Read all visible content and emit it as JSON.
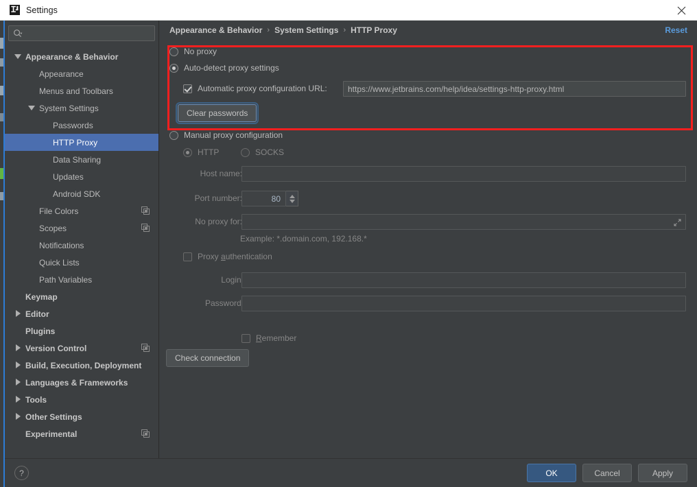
{
  "titlebar": {
    "title": "Settings",
    "app_icon": "intellij-idea-icon",
    "close_icon": "close-icon"
  },
  "sidebar": {
    "search": {
      "icon": "search-icon",
      "value": "",
      "placeholder": ""
    },
    "items": [
      {
        "label": "Appearance & Behavior",
        "depth": 0,
        "bold": true,
        "arrow": "down",
        "selected": false,
        "copy": false
      },
      {
        "label": "Appearance",
        "depth": 1,
        "bold": false,
        "arrow": "none",
        "selected": false,
        "copy": false
      },
      {
        "label": "Menus and Toolbars",
        "depth": 1,
        "bold": false,
        "arrow": "none",
        "selected": false,
        "copy": false
      },
      {
        "label": "System Settings",
        "depth": 1,
        "bold": false,
        "arrow": "down",
        "selected": false,
        "copy": false
      },
      {
        "label": "Passwords",
        "depth": 2,
        "bold": false,
        "arrow": "none",
        "selected": false,
        "copy": false
      },
      {
        "label": "HTTP Proxy",
        "depth": 2,
        "bold": false,
        "arrow": "none",
        "selected": true,
        "copy": false
      },
      {
        "label": "Data Sharing",
        "depth": 2,
        "bold": false,
        "arrow": "none",
        "selected": false,
        "copy": false
      },
      {
        "label": "Updates",
        "depth": 2,
        "bold": false,
        "arrow": "none",
        "selected": false,
        "copy": false
      },
      {
        "label": "Android SDK",
        "depth": 2,
        "bold": false,
        "arrow": "none",
        "selected": false,
        "copy": false
      },
      {
        "label": "File Colors",
        "depth": 1,
        "bold": false,
        "arrow": "none",
        "selected": false,
        "copy": true
      },
      {
        "label": "Scopes",
        "depth": 1,
        "bold": false,
        "arrow": "none",
        "selected": false,
        "copy": true
      },
      {
        "label": "Notifications",
        "depth": 1,
        "bold": false,
        "arrow": "none",
        "selected": false,
        "copy": false
      },
      {
        "label": "Quick Lists",
        "depth": 1,
        "bold": false,
        "arrow": "none",
        "selected": false,
        "copy": false
      },
      {
        "label": "Path Variables",
        "depth": 1,
        "bold": false,
        "arrow": "none",
        "selected": false,
        "copy": false
      },
      {
        "label": "Keymap",
        "depth": 0,
        "bold": true,
        "arrow": "none",
        "selected": false,
        "copy": false
      },
      {
        "label": "Editor",
        "depth": 0,
        "bold": true,
        "arrow": "right",
        "selected": false,
        "copy": false
      },
      {
        "label": "Plugins",
        "depth": 0,
        "bold": true,
        "arrow": "none",
        "selected": false,
        "copy": false
      },
      {
        "label": "Version Control",
        "depth": 0,
        "bold": true,
        "arrow": "right",
        "selected": false,
        "copy": true
      },
      {
        "label": "Build, Execution, Deployment",
        "depth": 0,
        "bold": true,
        "arrow": "right",
        "selected": false,
        "copy": false
      },
      {
        "label": "Languages & Frameworks",
        "depth": 0,
        "bold": true,
        "arrow": "right",
        "selected": false,
        "copy": false
      },
      {
        "label": "Tools",
        "depth": 0,
        "bold": true,
        "arrow": "right",
        "selected": false,
        "copy": false
      },
      {
        "label": "Other Settings",
        "depth": 0,
        "bold": true,
        "arrow": "right",
        "selected": false,
        "copy": false
      },
      {
        "label": "Experimental",
        "depth": 0,
        "bold": true,
        "arrow": "none",
        "selected": false,
        "copy": true
      }
    ]
  },
  "breadcrumb": {
    "items": [
      "Appearance & Behavior",
      "System Settings",
      "HTTP Proxy"
    ],
    "separator": "›",
    "reset_label": "Reset"
  },
  "proxy": {
    "no_proxy_label": "No proxy",
    "no_proxy_selected": false,
    "auto_detect_label": "Auto-detect proxy settings",
    "auto_detect_selected": true,
    "auto_url_checkbox_label": "Automatic proxy configuration URL:",
    "auto_url_checked": true,
    "auto_url_value": "https://www.jetbrains.com/help/idea/settings-http-proxy.html",
    "clear_passwords_label": "Clear passwords",
    "manual_label": "Manual proxy configuration",
    "manual_selected": false,
    "http_label": "HTTP",
    "http_selected": true,
    "socks_label": "SOCKS",
    "socks_selected": false,
    "host_label": "Host name:",
    "host_value": "",
    "port_label": "Port number:",
    "port_value": "80",
    "no_proxy_for_label": "No proxy for:",
    "no_proxy_for_value": "",
    "no_proxy_for_expand_icon": "expand-icon",
    "example_text": "Example: *.domain.com, 192.168.*",
    "auth_label": "Proxy authentication",
    "auth_mnemonic": "a",
    "auth_checked": false,
    "login_label": "Login:",
    "login_value": "",
    "password_label": "Password:",
    "password_value": "",
    "remember_label": "Remember",
    "remember_mnemonic": "R",
    "remember_checked": false,
    "check_connection_label": "Check connection"
  },
  "footer": {
    "help_label": "?",
    "ok_label": "OK",
    "cancel_label": "Cancel",
    "apply_label": "Apply"
  },
  "colors": {
    "accent_blue": "#4b6eaf",
    "link_blue": "#5a9bdc",
    "highlight_red": "#f51f1f",
    "dialog_bg": "#3c3f41",
    "primary_button": "#365880"
  }
}
